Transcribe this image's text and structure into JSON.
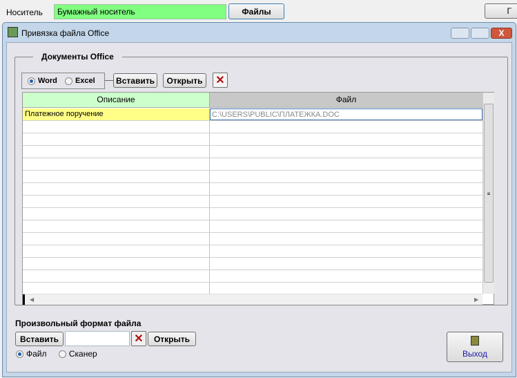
{
  "top": {
    "carrier_label": "Носитель",
    "carrier_value": "Бумажный носитель",
    "files_button": "Файлы",
    "right_button": "Г"
  },
  "window": {
    "title": "Привязка файла Office"
  },
  "group": {
    "title": "Документы Office",
    "radio_word": "Word",
    "radio_excel": "Excel",
    "insert_button": "Вставить",
    "open_button": "Открыть",
    "selected": "Word"
  },
  "grid": {
    "columns": [
      "Описание",
      "Файл"
    ],
    "rows": [
      {
        "description": "Платежное поручение",
        "file": "C:\\USERS\\PUBLIC\\ПЛАТЕЖКА.DOC"
      }
    ]
  },
  "custom": {
    "title": "Произвольный формат файла",
    "insert_button": "Вставить",
    "input_value": "",
    "open_button": "Открыть",
    "radio_file": "Файл",
    "radio_scanner": "Сканер",
    "selected": "Файл"
  },
  "exit_button": "Выход"
}
